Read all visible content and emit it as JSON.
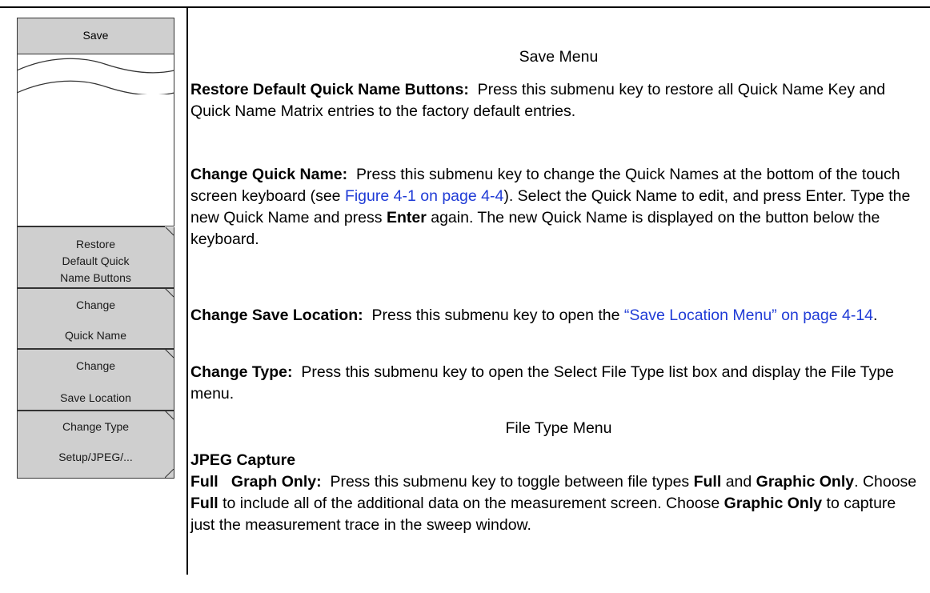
{
  "menu": {
    "title": "Save",
    "keys": [
      {
        "lines": [
          "Restore",
          "Default Quick",
          "Name Buttons"
        ]
      },
      {
        "line1": "Change",
        "line2": "Quick Name"
      },
      {
        "line1": "Change",
        "line2": "Save Location"
      },
      {
        "line1": "Change Type",
        "line2": "Setup/JPEG/..."
      }
    ]
  },
  "content": {
    "save_menu_caption": "Save Menu",
    "restore": {
      "term": "Restore Default Quick Name Buttons:",
      "text": "Press this submenu key to restore all Quick Name Key and Quick Name Matrix entries to the factory default entries."
    },
    "change_quick_name": {
      "term": "Change Quick Name:",
      "text1": "Press this submenu key to change the Quick Names at the bottom of the touch screen keyboard (see ",
      "link": "Figure 4-1 on page 4-4",
      "text2": "). Select the Quick Name to edit, and press Enter. Type the new Quick Name and press ",
      "enter": "Enter",
      "text3": " again. The new Quick Name is displayed on the button below the keyboard."
    },
    "change_save_location": {
      "term": "Change Save Location:",
      "text": "Press this submenu key to open the ",
      "link": "“Save Location Menu” on page 4-14",
      "end": "."
    },
    "change_type": {
      "term": "Change Type:",
      "text": "Press this submenu key to open the Select File Type list box and display the File Type menu."
    },
    "file_type_caption": "File Type Menu",
    "jpeg_heading": "JPEG Capture",
    "full_graph": {
      "term": "Full   Graph Only:",
      "t1": "Press this submenu key to toggle between file types ",
      "full1": "Full",
      "t2": "and ",
      "graphic1": "Graphic Only",
      "t3": ". Choose ",
      "full2": "Full",
      "t4": " to include all of the additional data on the measurement screen. Choose ",
      "graphic2": "Graphic Only",
      "t5": " to capture just the measurement trace in the sweep window."
    }
  }
}
